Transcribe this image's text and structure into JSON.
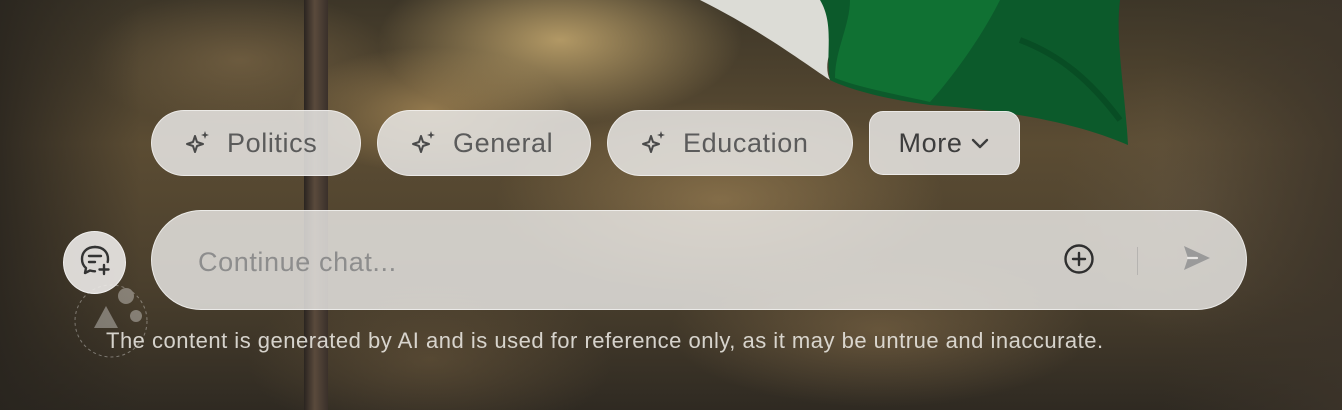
{
  "chips": [
    {
      "label": "Politics",
      "icon": "sparkle-icon"
    },
    {
      "label": "General",
      "icon": "sparkle-icon"
    },
    {
      "label": "Education",
      "icon": "sparkle-icon"
    }
  ],
  "more": {
    "label": "More",
    "icon": "chevron-down-icon"
  },
  "new_chat": {
    "icon": "new-chat-icon"
  },
  "input": {
    "placeholder": "Continue chat...",
    "value": ""
  },
  "attach": {
    "icon": "plus-circle-icon"
  },
  "send": {
    "icon": "send-icon"
  },
  "disclaimer": "The content is generated by AI and is used for reference only, as it may be untrue and inaccurate.",
  "colors": {
    "flag_green": "#0b5a2a",
    "flag_white": "#e8e8e4",
    "chip_text": "#5b5b5b",
    "chip_bg": "#e8e6e4"
  }
}
